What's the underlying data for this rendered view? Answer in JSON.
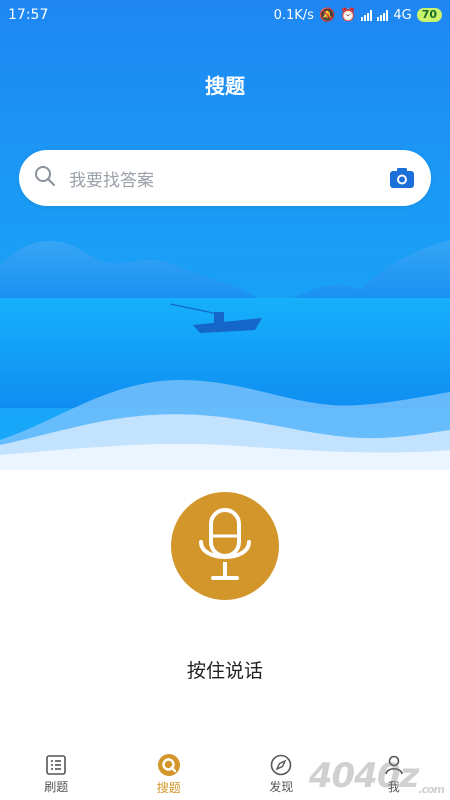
{
  "status_bar": {
    "time": "17:57",
    "net_speed": "0.1K/s",
    "network": "4G",
    "battery": "70"
  },
  "header": {
    "title": "搜题"
  },
  "search": {
    "placeholder": "我要找答案"
  },
  "voice": {
    "hint": "按住说话"
  },
  "tabs": [
    {
      "label": "刷题",
      "icon": "list-icon",
      "active": false
    },
    {
      "label": "搜题",
      "icon": "search-q-icon",
      "active": true
    },
    {
      "label": "发现",
      "icon": "compass-icon",
      "active": false
    },
    {
      "label": "我",
      "icon": "person-icon",
      "active": false
    }
  ],
  "watermark": {
    "text": "4040z",
    "suffix": ".com"
  },
  "colors": {
    "accent": "#d3962b",
    "hero_blue": "#1f86f3"
  }
}
